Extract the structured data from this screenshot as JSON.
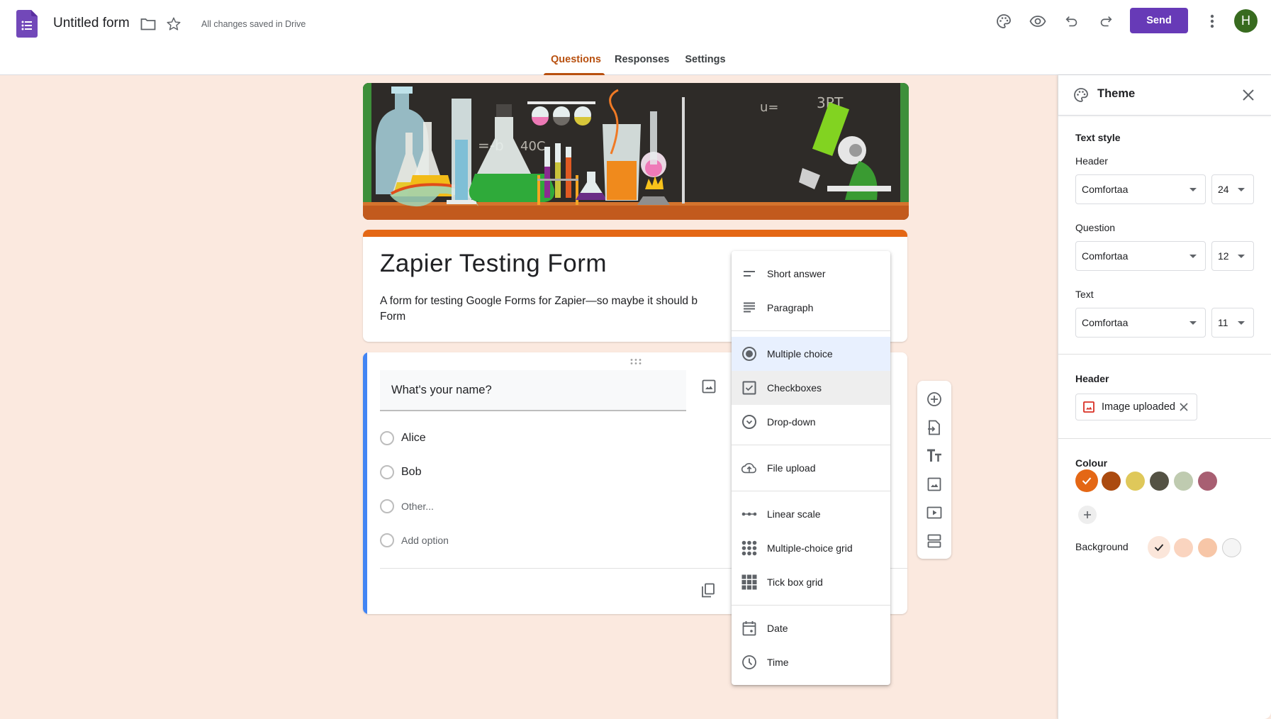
{
  "app": {
    "doc_title": "Untitled form",
    "save_status": "All changes saved in Drive",
    "send_label": "Send",
    "avatar_initial": "H",
    "brand_color": "#673ab7",
    "avatar_color": "#386b1f"
  },
  "tabs": [
    {
      "label": "Questions",
      "active": true
    },
    {
      "label": "Responses",
      "active": false
    },
    {
      "label": "Settings",
      "active": false
    }
  ],
  "form": {
    "header_image": "laboratory-illustration",
    "title": "Zapier Testing Form",
    "description_line1": "A form for testing Google Forms for Zapier—so maybe it should b",
    "description_line2": "Form",
    "accent_color": "#e46715"
  },
  "question": {
    "title": "What's your name?",
    "options": [
      {
        "label": "Alice"
      },
      {
        "label": "Bob"
      },
      {
        "label": "Other..."
      },
      {
        "label": "Add option"
      }
    ]
  },
  "side_toolbar": [
    {
      "icon": "add-question-icon"
    },
    {
      "icon": "import-questions-icon"
    },
    {
      "icon": "add-title-icon"
    },
    {
      "icon": "add-image-icon"
    },
    {
      "icon": "add-video-icon"
    },
    {
      "icon": "add-section-icon"
    }
  ],
  "type_menu": {
    "groups": [
      [
        {
          "label": "Short answer",
          "icon": "short-answer-icon"
        },
        {
          "label": "Paragraph",
          "icon": "paragraph-icon"
        }
      ],
      [
        {
          "label": "Multiple choice",
          "icon": "radio-icon",
          "state": "selected"
        },
        {
          "label": "Checkboxes",
          "icon": "checkbox-icon",
          "state": "hover"
        },
        {
          "label": "Drop-down",
          "icon": "dropdown-icon"
        }
      ],
      [
        {
          "label": "File upload",
          "icon": "cloud-upload-icon"
        }
      ],
      [
        {
          "label": "Linear scale",
          "icon": "linear-scale-icon"
        },
        {
          "label": "Multiple-choice grid",
          "icon": "dot-grid-icon"
        },
        {
          "label": "Tick box grid",
          "icon": "square-grid-icon"
        }
      ],
      [
        {
          "label": "Date",
          "icon": "calendar-icon"
        },
        {
          "label": "Time",
          "icon": "clock-icon"
        }
      ]
    ]
  },
  "theme_panel": {
    "title": "Theme",
    "text_style_title": "Text style",
    "header_label": "Header",
    "header_font": "Comfortaa",
    "header_size": "24",
    "question_label": "Question",
    "question_font": "Comfortaa",
    "question_size": "12",
    "text_label": "Text",
    "text_font": "Comfortaa",
    "text_size": "11",
    "header_section_title": "Header",
    "header_chip_label": "Image uploaded",
    "colour_title": "Colour",
    "colours": [
      "#e46715",
      "#ab4a0f",
      "#dfc85a",
      "#545244",
      "#bfcbb0",
      "#a85f72"
    ],
    "selected_colour": "#e46715",
    "background_label": "Background",
    "backgrounds": [
      "#fbe6da",
      "#fad4bf",
      "#f7c6a7",
      "#f5f5f5"
    ],
    "selected_background": "#fbe6da"
  }
}
